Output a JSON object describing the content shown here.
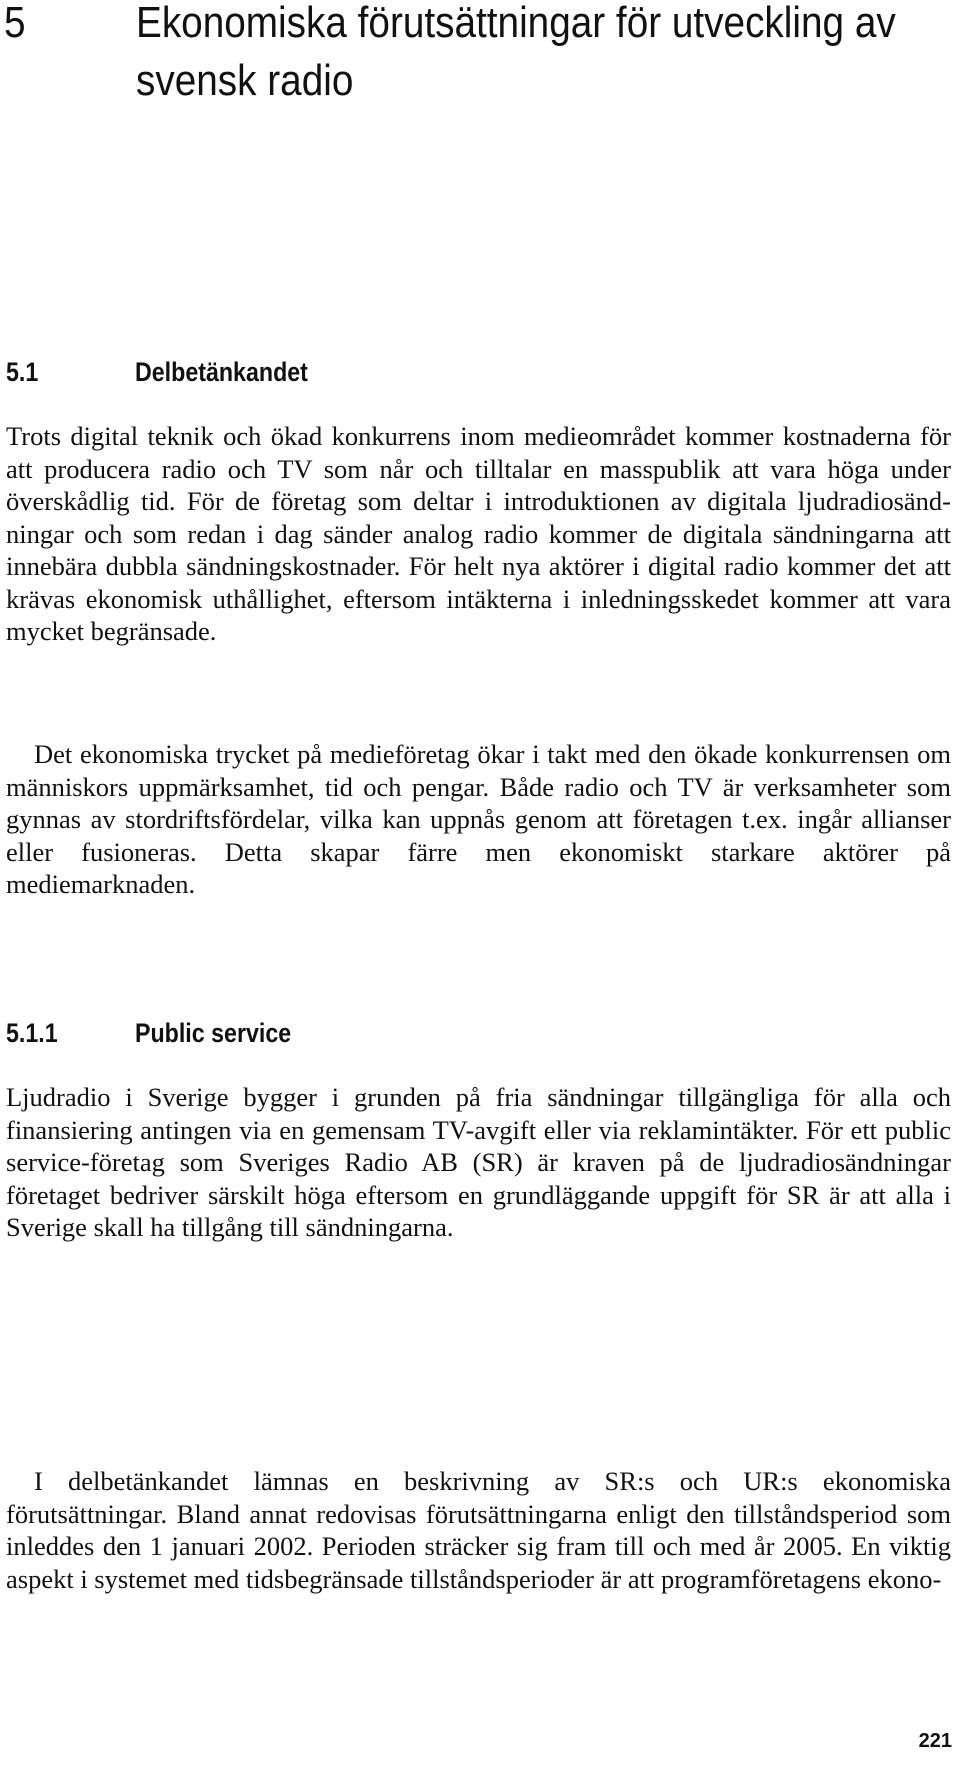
{
  "chapter": {
    "number": "5",
    "title": "Ekonomiska förutsättningar för utveckling av svensk radio"
  },
  "section": {
    "number": "5.1",
    "title": "Delbetänkandet",
    "paragraphs": [
      "Trots digital teknik och ökad konkurrens inom medieområdet kommer kostnaderna för att producera radio och TV som når och tilltalar en masspublik att vara höga under överskådlig tid. För de företag som deltar i introduktionen av digitala ljudradiosänd­ningar och som redan i dag sänder analog radio kommer de digi­tala sändningarna att innebära dubbla sändningskostnader. För helt nya aktörer i digital radio kommer det att krävas ekonomisk ut­hållighet, eftersom intäkterna i inledningsskedet kommer att vara mycket begränsade.",
      "Det ekonomiska trycket på medieföretag ökar i takt med den ökade konkurrensen om människors uppmärksamhet, tid och pengar. Både radio och TV är verksamheter som gynnas av stordriftsför­delar, vilka kan uppnås genom att företagen t.ex. ingår allianser eller fusioneras. Detta skapar färre men ekonomiskt starkare aktörer på mediemarknaden."
    ]
  },
  "subsection": {
    "number": "5.1.1",
    "title": "Public service",
    "paragraphs": [
      "Ljudradio i Sverige bygger i grunden på fria sändningar tillgängliga för alla och finansiering antingen via en gemensam TV-avgift eller via reklamintäkter. För ett public service-företag som Sveriges Radio AB (SR) är kraven på de ljudradiosändningar företaget bedriver särskilt höga eftersom en grundläggande uppgift för SR är att alla i Sverige skall ha tillgång till sändningarna.",
      "I delbetänkandet lämnas en beskrivning av SR:s och UR:s ekono­miska förutsättningar. Bland annat redovisas förutsättningarna enligt den tillståndsperiod som inleddes den 1 januari 2002. Perioden sträcker sig fram till och med år 2005. En viktig aspekt i systemet med tidsbegränsade tillståndsperioder är att programföretagens ekono-"
    ]
  },
  "footer": {
    "page_number": "221"
  }
}
